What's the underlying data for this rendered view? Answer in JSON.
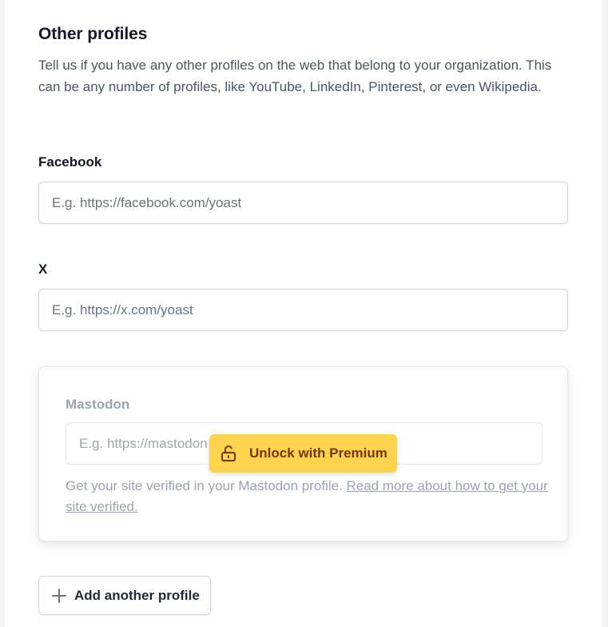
{
  "section": {
    "title": "Other profiles",
    "description": "Tell us if you have any other profiles on the web that belong to your organization. This can be any number of profiles, like YouTube, LinkedIn, Pinterest, or even Wikipedia."
  },
  "fields": {
    "facebook": {
      "label": "Facebook",
      "placeholder": "E.g. https://facebook.com/yoast",
      "value": ""
    },
    "x": {
      "label": "X",
      "placeholder": "E.g. https://x.com/yoast",
      "value": ""
    }
  },
  "premium": {
    "mastodon_label": "Mastodon",
    "mastodon_placeholder": "E.g. https://mastodon",
    "help_text": "Get your site verified in your Mastodon profile. ",
    "help_link": "Read more about how to get your site verified.",
    "unlock_label": "Unlock with Premium",
    "unlock_icon": "lock-open-icon",
    "accent_color": "#fcd34d"
  },
  "actions": {
    "add_profile_label": "Add another profile",
    "add_icon": "plus-icon"
  }
}
